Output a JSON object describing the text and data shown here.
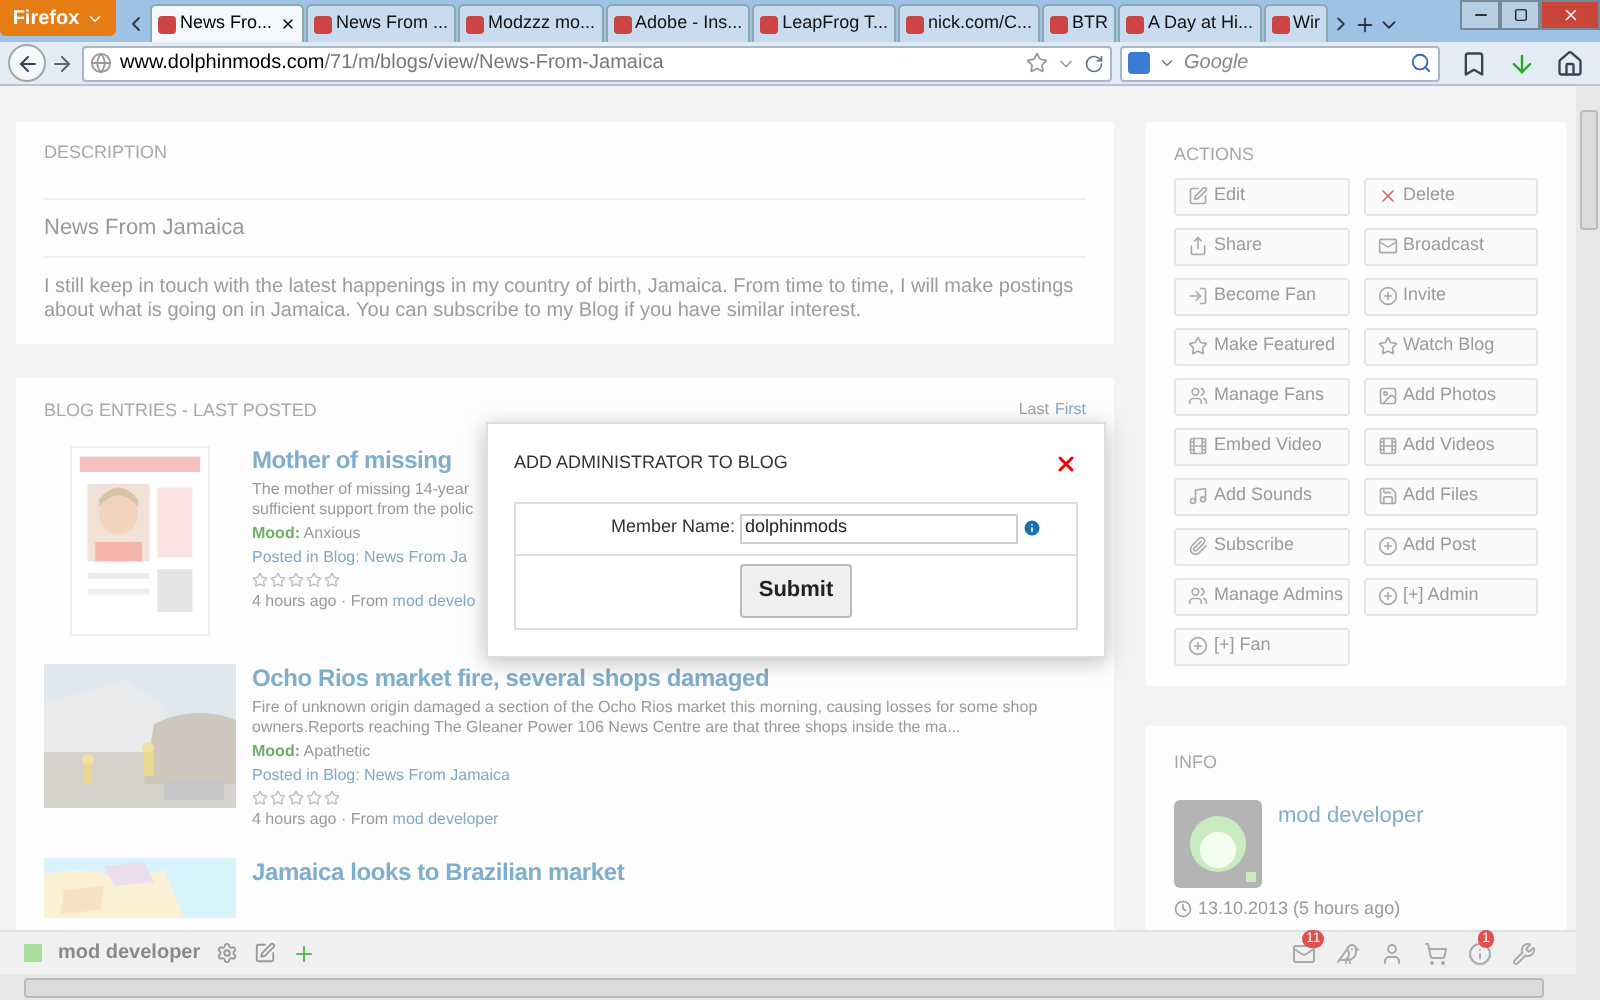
{
  "browser": {
    "menu_button": "Firefox",
    "tabs": [
      {
        "label": "News Fro...",
        "selected": true
      },
      {
        "label": "News From ...",
        "selected": false
      },
      {
        "label": "Modzzz mo...",
        "selected": false
      },
      {
        "label": "Adobe - Ins...",
        "selected": false
      },
      {
        "label": "LeapFrog T...",
        "selected": false
      },
      {
        "label": "nick.com/C...",
        "selected": false
      },
      {
        "label": "BTR",
        "selected": false
      },
      {
        "label": "A Day at Hi...",
        "selected": false
      },
      {
        "label": "Wir",
        "selected": false
      }
    ],
    "url_host": "www.dolphinmods.com",
    "url_path": "/71/m/blogs/view/News-From-Jamaica",
    "search": {
      "placeholder": "Google"
    }
  },
  "description": {
    "heading": "DESCRIPTION",
    "title": "News From Jamaica",
    "text": "I still keep in touch with the latest happenings in my country of birth, Jamaica. From time to time, I will make postings about what is going on in Jamaica. You can subscribe to my Blog if you have similar interest."
  },
  "blog_entries": {
    "heading": "BLOG ENTRIES - LAST POSTED",
    "sort": [
      {
        "label": "Last",
        "selected": true
      },
      {
        "label": "First",
        "selected": false
      }
    ],
    "entries": [
      {
        "title": "Mother of missing",
        "excerpt_lines": [
          "The mother of missing 14-year",
          "sufficient support from the polic"
        ],
        "mood_label": "Mood:",
        "mood": "Anxious",
        "posted": "Posted in Blog: News From Ja",
        "stars": 0,
        "time": "4 hours ago",
        "from": "· From ",
        "author": "mod develo"
      },
      {
        "title": "Ocho Rios market fire, several shops damaged",
        "excerpt_lines": [
          "Fire of unknown origin damaged a section of the Ocho Rios market this morning, causing losses for some shop",
          "owners.Reports reaching The Gleaner Power 106 News Centre are that three shops inside the ma..."
        ],
        "mood_label": "Mood:",
        "mood": "Apathetic",
        "posted": "Posted in Blog: News From Jamaica",
        "stars": 0,
        "time": "4 hours ago",
        "from": "· From ",
        "author": "mod developer"
      },
      {
        "title": "Jamaica looks to Brazilian market"
      }
    ]
  },
  "actions": {
    "heading": "ACTIONS",
    "buttons": [
      "Edit",
      "Delete",
      "Share",
      "Broadcast",
      "Become Fan",
      "Invite",
      "Make Featured",
      "Watch Blog",
      "Manage Fans",
      "Add Photos",
      "Embed Video",
      "Add Videos",
      "Add Sounds",
      "Add Files",
      "Subscribe",
      "Add Post",
      "Manage Admins",
      "[+] Admin",
      "[+] Fan"
    ]
  },
  "info": {
    "heading": "INFO",
    "author": "mod developer",
    "date": "13.10.2013 (5 hours ago)"
  },
  "dialog": {
    "title": "ADD ADMINISTRATOR TO BLOG",
    "field_label": "Member Name:",
    "field_value": "dolphinmods",
    "submit": "Submit"
  },
  "bottom_bar": {
    "user": "mod developer",
    "mail_badge": "11",
    "info_badge": "1"
  }
}
